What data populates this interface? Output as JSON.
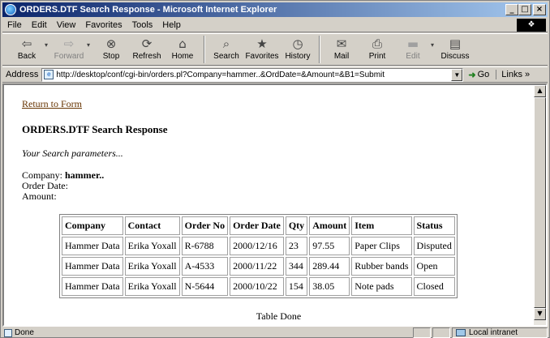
{
  "window": {
    "title": "ORDERS.DTF Search Response - Microsoft Internet Explorer",
    "controls": {
      "minimize": "_",
      "maximize": "□",
      "close": "×"
    }
  },
  "menu": [
    {
      "label": "File"
    },
    {
      "label": "Edit"
    },
    {
      "label": "View"
    },
    {
      "label": "Favorites"
    },
    {
      "label": "Tools"
    },
    {
      "label": "Help"
    }
  ],
  "toolbar": {
    "back": {
      "label": "Back",
      "icon": "back-arrow-icon"
    },
    "forward": {
      "label": "Forward",
      "icon": "forward-arrow-icon"
    },
    "stop": {
      "label": "Stop",
      "icon": "stop-icon"
    },
    "refresh": {
      "label": "Refresh",
      "icon": "refresh-icon"
    },
    "home": {
      "label": "Home",
      "icon": "home-icon"
    },
    "search": {
      "label": "Search",
      "icon": "search-icon"
    },
    "favorites": {
      "label": "Favorites",
      "icon": "favorites-icon"
    },
    "history": {
      "label": "History",
      "icon": "history-icon"
    },
    "mail": {
      "label": "Mail",
      "icon": "mail-icon"
    },
    "print": {
      "label": "Print",
      "icon": "print-icon"
    },
    "edit": {
      "label": "Edit",
      "icon": "edit-icon"
    },
    "discuss": {
      "label": "Discuss",
      "icon": "discuss-icon"
    }
  },
  "address": {
    "label": "Address",
    "url": "http://desktop/conf/cgi-bin/orders.pl?Company=hammer..&OrdDate=&Amount=&B1=Submit",
    "go_label": "Go",
    "links_label": "Links »"
  },
  "page": {
    "return_link": "Return to Form",
    "title": "ORDERS.DTF Search Response",
    "params_heading": "Your Search parameters...",
    "params": {
      "company_label": "Company:",
      "company_value": "hammer..",
      "order_date_label": "Order Date:",
      "amount_label": "Amount:"
    },
    "table": {
      "headers": [
        "Company",
        "Contact",
        "Order No",
        "Order Date",
        "Qty",
        "Amount",
        "Item",
        "Status"
      ],
      "rows": [
        [
          "Hammer Data",
          "Erika Yoxall",
          "R-6788",
          "2000/12/16",
          "23",
          "97.55",
          "Paper Clips",
          "Disputed"
        ],
        [
          "Hammer Data",
          "Erika Yoxall",
          "A-4533",
          "2000/11/22",
          "344",
          "289.44",
          "Rubber bands",
          "Open"
        ],
        [
          "Hammer Data",
          "Erika Yoxall",
          "N-5644",
          "2000/10/22",
          "154",
          "38.05",
          "Note pads",
          "Closed"
        ]
      ]
    },
    "table_done": "Table Done"
  },
  "status": {
    "text": "Done",
    "zone": "Local intranet"
  }
}
